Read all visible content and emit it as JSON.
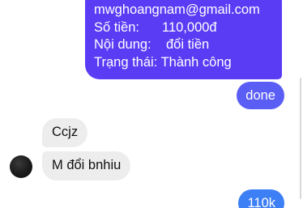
{
  "sent_info": {
    "email": "mwghoangnam@gmail.com",
    "amount_label": "Số tiền:",
    "amount_value": "110,000đ",
    "content_label": "Nội dung:",
    "content_value": "đổi tiền",
    "status_label": "Trạng thái:",
    "status_value": "Thành công"
  },
  "messages": {
    "sent_done": "done",
    "recv_1": "Ccjz",
    "recv_2": "M đổi bnhiu",
    "sent_amount": "110k"
  },
  "colors": {
    "sent_bubble_top": "#5b3cf5",
    "sent_bubble_mid": "#5a5ef5",
    "sent_bubble_bottom": "#3d7ff5",
    "received_bubble": "#ededed"
  }
}
